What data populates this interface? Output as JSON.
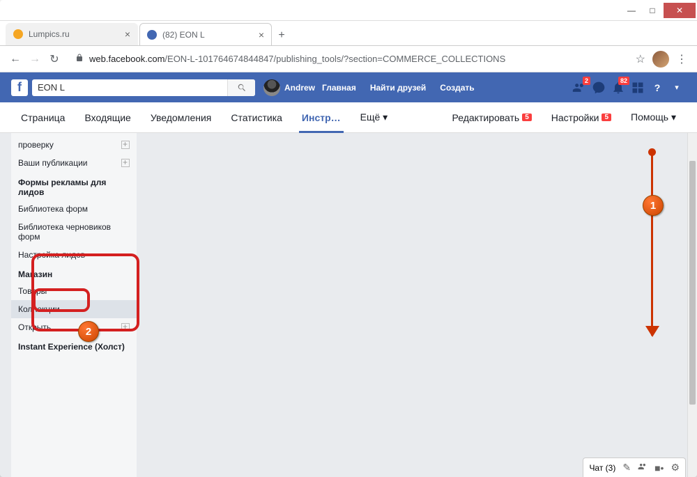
{
  "window": {
    "min": "—",
    "max": "□",
    "close": "✕"
  },
  "tabs": {
    "t1": "Lumpics.ru",
    "t2": "(82) EON L",
    "close": "×",
    "new": "+"
  },
  "addr": {
    "back": "←",
    "fwd": "→",
    "reload": "↻",
    "host": "web.facebook.com",
    "path": "/EON-L-101764674844847/publishing_tools/?section=COMMERCE_COLLECTIONS",
    "star": "☆",
    "dots": "⋮"
  },
  "fb": {
    "logo": "f",
    "search": "EON L",
    "profile": "Andrew",
    "nav1": "Главная",
    "nav2": "Найти друзей",
    "nav3": "Создать",
    "b1": "2",
    "b2": "82",
    "help": "?",
    "chev": "▾"
  },
  "tabbar": {
    "t1": "Страница",
    "t2": "Входящие",
    "t3": "Уведомления",
    "t4": "Статистика",
    "t5": "Инстр…",
    "t6": "Ещё ▾",
    "r1": "Редактировать",
    "r2": "Настройки",
    "r3": "Помощь ▾",
    "badge": "5"
  },
  "sb": {
    "i1a": "проверку",
    "i2": "Ваши публикации",
    "h1": "Формы рекламы для лидов",
    "i3": "Библиотека форм",
    "i4": "Библиотека черновиков форм",
    "i5": "Настройка лидов",
    "h2": "Магазин",
    "i6": "Товары",
    "i7": "Коллекции",
    "i8": "Открыть",
    "h3": "Instant Experience (Холст)"
  },
  "chat": {
    "label": "Чат (3)"
  },
  "annot": {
    "n1": "1",
    "n2": "2"
  }
}
